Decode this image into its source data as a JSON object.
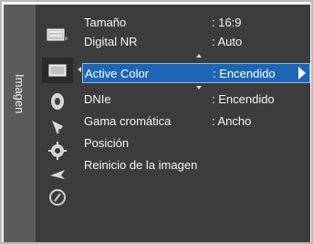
{
  "sidebar": {
    "section_title": "Imagen",
    "icons": [
      {
        "name": "picture-tv-icon"
      },
      {
        "name": "picture-settings-icon",
        "active": true
      },
      {
        "name": "sound-icon"
      },
      {
        "name": "channel-icon"
      },
      {
        "name": "settings-gear-icon"
      },
      {
        "name": "input-icon"
      },
      {
        "name": "support-icon"
      }
    ]
  },
  "menu": {
    "items": [
      {
        "label": "Tamaño",
        "value": ": 16:9"
      },
      {
        "label": "Digital NR",
        "value": ": Auto"
      },
      {
        "label": "Active Color",
        "value": ": Encendido"
      },
      {
        "label": "DNIe",
        "value": ": Encendido"
      },
      {
        "label": "Gama cromática",
        "value": ": Ancho"
      },
      {
        "label": "Posición",
        "value": ""
      },
      {
        "label": "Reinicio de la imagen",
        "value": ""
      }
    ]
  },
  "colors": {
    "menu_background": "#3c3c3c",
    "strip_background": "#5b5b5b",
    "selected_background": "#1e66b3",
    "text": "#f4f4f4"
  }
}
